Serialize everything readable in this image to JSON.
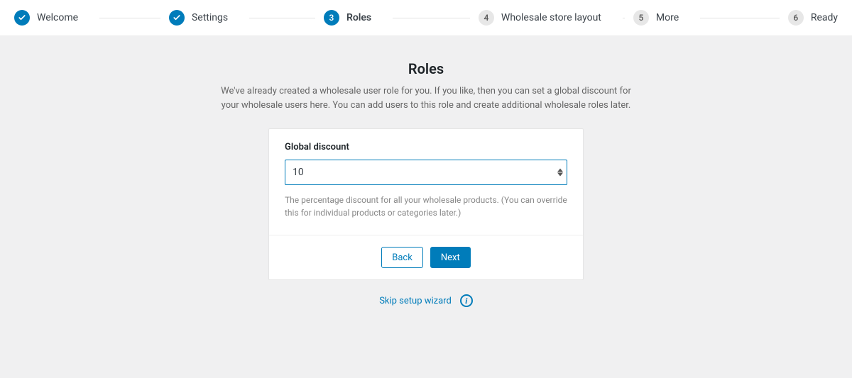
{
  "stepper": {
    "steps": [
      {
        "label": "Welcome",
        "state": "done"
      },
      {
        "label": "Settings",
        "state": "done"
      },
      {
        "label": "Roles",
        "state": "current",
        "num": "3"
      },
      {
        "label": "Wholesale store layout",
        "state": "todo",
        "num": "4"
      },
      {
        "label": "More",
        "state": "todo",
        "num": "5"
      },
      {
        "label": "Ready",
        "state": "todo",
        "num": "6"
      }
    ]
  },
  "page": {
    "title": "Roles",
    "subtitle": "We've already created a wholesale user role for you. If you like, then you can set a global discount for your wholesale users here. You can add users to this role and create additional wholesale roles later."
  },
  "form": {
    "global_discount_label": "Global discount",
    "global_discount_value": "10",
    "global_discount_help": "The percentage discount for all your wholesale products. (You can override this for individual products or categories later.)"
  },
  "buttons": {
    "back": "Back",
    "next": "Next"
  },
  "footer": {
    "skip": "Skip setup wizard"
  }
}
